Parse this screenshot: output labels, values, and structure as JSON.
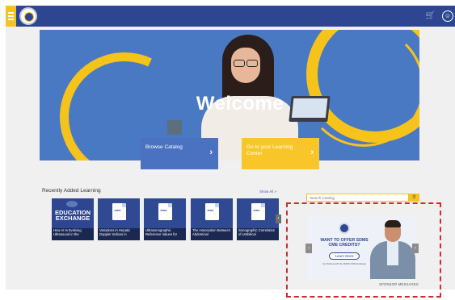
{
  "header": {
    "menu_icon": "hamburger-icon",
    "logo_icon": "sdms-seal-logo",
    "cart_icon": "cart-icon",
    "user_icon": "user-icon",
    "colors": {
      "bar": "#2e4591",
      "accent": "#f6c31b"
    }
  },
  "hero": {
    "title": "Welcome",
    "cta_browse": {
      "label": "Browse Catalog",
      "icon": "chevron-right-icon"
    },
    "cta_learning": {
      "label": "Go to your Learning Center",
      "icon": "chevron-right-icon"
    }
  },
  "recent": {
    "title": "Recently Added Learning",
    "show_all": "Show All >",
    "next_icon": "chevron-right-icon",
    "cards": [
      {
        "badge": "EDUCATION EXCHANGE",
        "caption": "How AI Is Evolving Ultrasound in the"
      },
      {
        "badge": "JDMS",
        "caption": "Variations in Hepatic Doppler Indices in"
      },
      {
        "badge": "JDMS",
        "caption": "Ultrasonographic Reference Values for"
      },
      {
        "badge": "JDMS",
        "caption": "The Association Between Abdominal"
      },
      {
        "badge": "JDMS",
        "caption": "Sonographic Correlation of Umbilical"
      }
    ]
  },
  "sidebar": {
    "search_placeholder": "Search Catalog",
    "search_icon": "search-icon",
    "ad": {
      "headline": "WANT TO OFFER SDMS CME CREDITS?",
      "button": "Learn More",
      "fine_print": "Get Started with the SDMS CME Exchange",
      "prev_icon": "chevron-left-icon",
      "next_icon": "chevron-right-icon"
    },
    "sponsor_label": "SPONSOR MESSAGES",
    "highlight_color": "#d22b2b"
  }
}
